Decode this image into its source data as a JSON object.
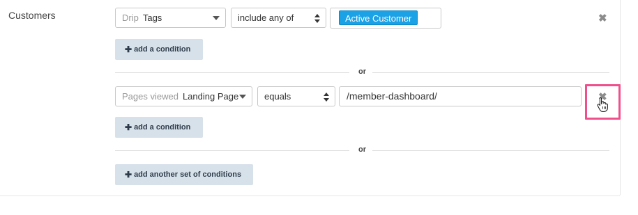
{
  "section": {
    "label": "Customers"
  },
  "group1": {
    "field_select": {
      "prefix": "Drip",
      "value": "Tags"
    },
    "operator_select": {
      "value": "include any of"
    },
    "tag_value": "Active Customer",
    "add_condition_label": "add a condition"
  },
  "separator_1": "or",
  "group2": {
    "field_select": {
      "prefix": "Pages viewed",
      "value": "Landing Page"
    },
    "operator_select": {
      "value": "equals"
    },
    "text_value": "/member-dashboard/",
    "add_condition_label": "add a condition"
  },
  "separator_2": "or",
  "add_set_label": "add another set of conditions",
  "icons": {
    "remove": "close-icon",
    "plus": "plus-icon",
    "cursor": "hand-pointer-icon"
  },
  "colors": {
    "tag_bg": "#1aa1e6",
    "button_bg": "#d7e1ea",
    "highlight": "#ef4f8b"
  }
}
